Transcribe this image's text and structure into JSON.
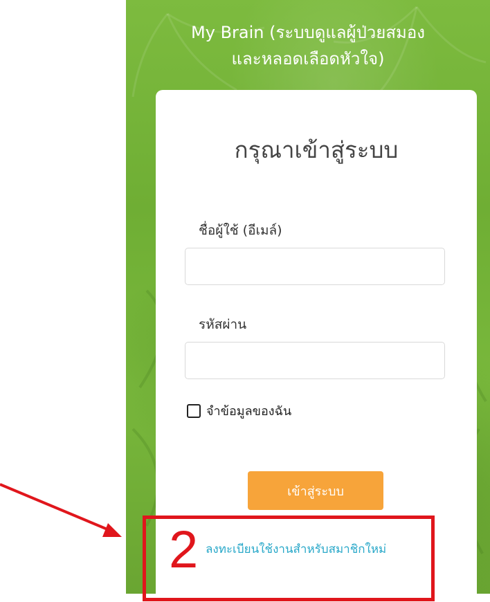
{
  "app": {
    "title": "My Brain (ระบบดูแลผู้ป่วยสมอง\nและหลอดเลือดหัวใจ)"
  },
  "login": {
    "heading": "กรุณาเข้าสู่ระบบ",
    "username_label": "ชื่อผู้ใช้ (อีเมล์)",
    "username_value": "",
    "password_label": "รหัสผ่าน",
    "password_value": "",
    "remember_label": "จำข้อมูลของฉัน",
    "remember_checked": false,
    "submit_label": "เข้าสู่ระบบ",
    "register_link": "ลงทะเบียนใช้งานสำหรับสมาชิกใหม่"
  },
  "annotation": {
    "step_number": "2",
    "highlight_color": "#e0161c"
  },
  "colors": {
    "background_green": "#7dbb3f",
    "button_orange": "#f7a43a",
    "link_blue": "#29a8c9"
  }
}
